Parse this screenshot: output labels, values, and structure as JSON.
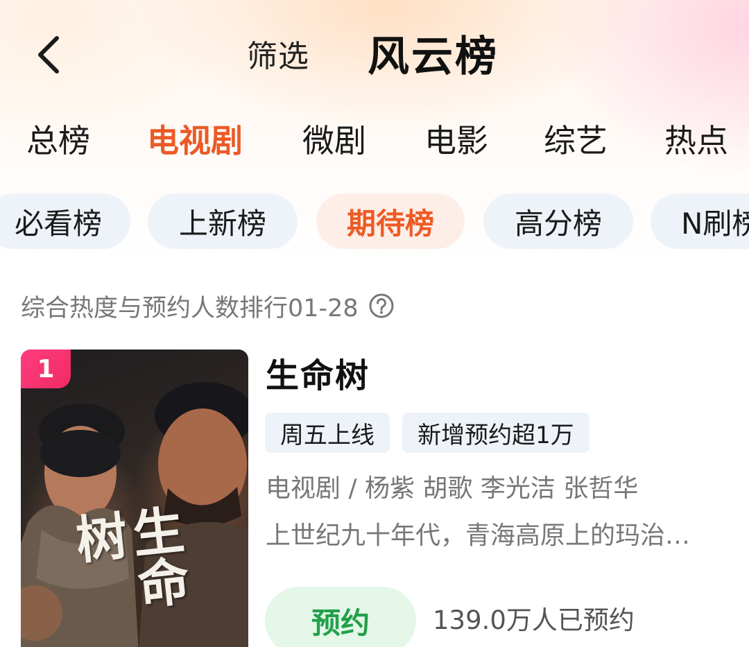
{
  "header": {
    "back_icon": "chevron-left-icon",
    "filter_label": "筛选",
    "title": "风云榜"
  },
  "category_tabs": [
    {
      "label": "总榜",
      "active": false
    },
    {
      "label": "电视剧",
      "active": true
    },
    {
      "label": "微剧",
      "active": false
    },
    {
      "label": "电影",
      "active": false
    },
    {
      "label": "综艺",
      "active": false
    },
    {
      "label": "热点",
      "active": false
    }
  ],
  "sub_tabs": [
    {
      "label": "必看榜",
      "active": false
    },
    {
      "label": "上新榜",
      "active": false
    },
    {
      "label": "期待榜",
      "active": true
    },
    {
      "label": "高分榜",
      "active": false
    },
    {
      "label": "N刷榜",
      "active": false
    }
  ],
  "ranking_description": "综合热度与预约人数排行01-28",
  "help_icon": "question-circle-icon",
  "items": [
    {
      "rank": "1",
      "title": "生命树",
      "poster_title": "生命树",
      "tags": [
        "周五上线",
        "新增预约超1万"
      ],
      "meta": "电视剧 / 杨紫 胡歌 李光洁 张哲华",
      "synopsis": "上世纪九十年代，青海高原上的玛治…",
      "reserve_label": "预约",
      "reserve_count": "139.0万人已预约"
    }
  ],
  "colors": {
    "accent_orange": "#ec5a26",
    "rank_badge": "#f02a63",
    "reserve_green": "#21a04a",
    "reserve_bg": "#e4f7e8",
    "chip_bg": "#eef3f9",
    "active_chip_bg": "#fdeee8"
  }
}
